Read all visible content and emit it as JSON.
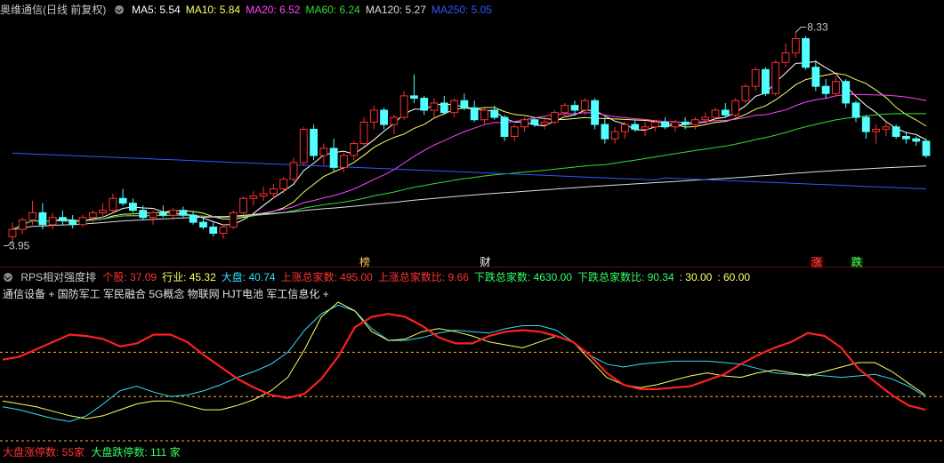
{
  "header": {
    "title": "奥维通信(日线 前复权)",
    "ma": [
      {
        "label": "MA5: 5.54",
        "color": "#ffffff"
      },
      {
        "label": "MA10: 5.84",
        "color": "#ffff66"
      },
      {
        "label": "MA20: 6.52",
        "color": "#ff44ff"
      },
      {
        "label": "MA60: 6.24",
        "color": "#33dd33"
      },
      {
        "label": "MA120: 5.27",
        "color": "#dddddd"
      },
      {
        "label": "MA250: 5.05",
        "color": "#3355ff"
      }
    ]
  },
  "price_chart": {
    "high_label": "8.33",
    "low_label": "3.95",
    "events": [
      {
        "text": "榜",
        "color": "#ffcc66"
      },
      {
        "text": "财",
        "color": "#ffffff"
      },
      {
        "text": "涨",
        "color": "#ff5555"
      },
      {
        "text": "跌",
        "color": "#66ff66"
      }
    ]
  },
  "rps": {
    "name": "RPS相对强度排",
    "items": [
      {
        "label": "个股: 37.09",
        "color": "#ff3333"
      },
      {
        "label": "行业: 45.32",
        "color": "#ffff66"
      },
      {
        "label": "大盘: 40.74",
        "color": "#33ddff"
      },
      {
        "label": "上涨总家数: 495.00",
        "color": "#ff3333"
      },
      {
        "label": "上涨总家数比: 9.66",
        "color": "#ff3333"
      },
      {
        "label": "下跌总家数: 4630.00",
        "color": "#33ff66"
      },
      {
        "label": "下跌总家数比: 90.34",
        "color": "#33ff66"
      },
      {
        "label": ": 30.00",
        "color": "#ffff66"
      },
      {
        "label": ": 60.00",
        "color": "#ffff66"
      }
    ],
    "sectors": "通信设备 + 国防军工 军民融合 5G概念 物联网 HJT电池 军工信息化 +",
    "limit_up": "大盘涨停数: 55家",
    "limit_down": "大盘跌停数: 111 家"
  },
  "chart_data": [
    {
      "type": "candlestick",
      "title": "奥维通信(日线 前复权)",
      "ylim": [
        3.7,
        8.6
      ],
      "annotations": {
        "max": 8.33,
        "min": 3.95
      },
      "ohlc": [
        [
          4.05,
          4.35,
          3.95,
          4.2
        ],
        [
          4.2,
          4.45,
          4.1,
          4.4
        ],
        [
          4.4,
          4.8,
          4.3,
          4.55
        ],
        [
          4.55,
          4.75,
          4.2,
          4.3
        ],
        [
          4.3,
          4.55,
          4.2,
          4.45
        ],
        [
          4.45,
          4.6,
          4.3,
          4.38
        ],
        [
          4.38,
          4.5,
          4.22,
          4.3
        ],
        [
          4.3,
          4.5,
          4.25,
          4.45
        ],
        [
          4.45,
          4.6,
          4.35,
          4.55
        ],
        [
          4.55,
          4.75,
          4.45,
          4.6
        ],
        [
          4.6,
          4.95,
          4.55,
          4.85
        ],
        [
          4.85,
          5.05,
          4.7,
          4.75
        ],
        [
          4.75,
          4.85,
          4.55,
          4.6
        ],
        [
          4.6,
          4.7,
          4.4,
          4.45
        ],
        [
          4.45,
          4.6,
          4.3,
          4.55
        ],
        [
          4.55,
          4.7,
          4.45,
          4.5
        ],
        [
          4.5,
          4.65,
          4.4,
          4.6
        ],
        [
          4.6,
          4.68,
          4.45,
          4.5
        ],
        [
          4.5,
          4.58,
          4.3,
          4.35
        ],
        [
          4.35,
          4.45,
          4.2,
          4.25
        ],
        [
          4.25,
          4.35,
          4.05,
          4.12
        ],
        [
          4.12,
          4.3,
          4.0,
          4.25
        ],
        [
          4.25,
          4.6,
          4.2,
          4.55
        ],
        [
          4.55,
          4.9,
          4.5,
          4.85
        ],
        [
          4.85,
          5.0,
          4.7,
          4.9
        ],
        [
          4.9,
          5.1,
          4.8,
          4.95
        ],
        [
          4.95,
          5.15,
          4.85,
          5.05
        ],
        [
          5.05,
          5.3,
          4.95,
          5.25
        ],
        [
          5.25,
          5.7,
          5.2,
          5.6
        ],
        [
          5.6,
          6.35,
          5.55,
          6.3
        ],
        [
          6.3,
          6.4,
          5.65,
          5.75
        ],
        [
          5.75,
          6.0,
          5.55,
          5.9
        ],
        [
          5.9,
          6.1,
          5.4,
          5.5
        ],
        [
          5.5,
          5.8,
          5.4,
          5.75
        ],
        [
          5.75,
          6.05,
          5.65,
          6.0
        ],
        [
          6.0,
          6.55,
          5.95,
          6.45
        ],
        [
          6.45,
          6.8,
          6.3,
          6.7
        ],
        [
          6.7,
          6.75,
          6.3,
          6.4
        ],
        [
          6.4,
          6.6,
          6.2,
          6.55
        ],
        [
          6.55,
          7.1,
          6.5,
          7.0
        ],
        [
          7.0,
          7.45,
          6.85,
          6.95
        ],
        [
          6.95,
          7.0,
          6.6,
          6.7
        ],
        [
          6.7,
          6.95,
          6.55,
          6.85
        ],
        [
          6.85,
          7.0,
          6.6,
          6.65
        ],
        [
          6.65,
          6.95,
          6.55,
          6.9
        ],
        [
          6.9,
          7.05,
          6.7,
          6.75
        ],
        [
          6.75,
          6.9,
          6.45,
          6.5
        ],
        [
          6.5,
          6.75,
          6.4,
          6.7
        ],
        [
          6.7,
          6.8,
          6.5,
          6.55
        ],
        [
          6.55,
          6.6,
          6.05,
          6.15
        ],
        [
          6.15,
          6.4,
          6.05,
          6.35
        ],
        [
          6.35,
          6.55,
          6.25,
          6.5
        ],
        [
          6.5,
          6.55,
          6.35,
          6.4
        ],
        [
          6.4,
          6.55,
          6.3,
          6.45
        ],
        [
          6.45,
          6.7,
          6.4,
          6.65
        ],
        [
          6.65,
          6.85,
          6.55,
          6.8
        ],
        [
          6.8,
          6.9,
          6.6,
          6.7
        ],
        [
          6.7,
          6.95,
          6.6,
          6.9
        ],
        [
          6.9,
          6.95,
          6.3,
          6.4
        ],
        [
          6.4,
          6.55,
          6.0,
          6.1
        ],
        [
          6.1,
          6.35,
          6.0,
          6.25
        ],
        [
          6.25,
          6.45,
          6.1,
          6.4
        ],
        [
          6.4,
          6.5,
          6.25,
          6.3
        ],
        [
          6.3,
          6.45,
          6.15,
          6.35
        ],
        [
          6.35,
          6.5,
          6.25,
          6.45
        ],
        [
          6.45,
          6.55,
          6.3,
          6.35
        ],
        [
          6.35,
          6.5,
          6.25,
          6.45
        ],
        [
          6.45,
          6.55,
          6.3,
          6.4
        ],
        [
          6.4,
          6.55,
          6.3,
          6.5
        ],
        [
          6.5,
          6.65,
          6.4,
          6.55
        ],
        [
          6.55,
          6.75,
          6.45,
          6.7
        ],
        [
          6.7,
          6.85,
          6.55,
          6.6
        ],
        [
          6.6,
          6.95,
          6.55,
          6.9
        ],
        [
          6.9,
          7.25,
          6.85,
          7.2
        ],
        [
          7.2,
          7.6,
          7.1,
          7.55
        ],
        [
          7.55,
          7.6,
          7.0,
          7.05
        ],
        [
          7.05,
          7.75,
          7.0,
          7.7
        ],
        [
          7.7,
          8.1,
          7.6,
          7.9
        ],
        [
          7.9,
          8.33,
          7.8,
          8.2
        ],
        [
          8.2,
          8.25,
          7.55,
          7.6
        ],
        [
          7.6,
          7.75,
          7.1,
          7.2
        ],
        [
          7.2,
          7.35,
          6.95,
          7.05
        ],
        [
          7.05,
          7.4,
          7.0,
          7.3
        ],
        [
          7.3,
          7.35,
          6.75,
          6.85
        ],
        [
          6.85,
          6.9,
          6.45,
          6.55
        ],
        [
          6.55,
          6.6,
          6.1,
          6.25
        ],
        [
          6.25,
          6.4,
          6.0,
          6.3
        ],
        [
          6.3,
          6.45,
          6.15,
          6.35
        ],
        [
          6.35,
          6.4,
          6.1,
          6.15
        ],
        [
          6.15,
          6.25,
          6.0,
          6.1
        ],
        [
          6.1,
          6.15,
          5.95,
          6.05
        ],
        [
          6.05,
          6.1,
          5.7,
          5.75
        ]
      ]
    },
    {
      "type": "line",
      "title": "RPS相对强度排",
      "ylim": [
        0,
        100
      ],
      "reference_lines": [
        30,
        60
      ],
      "series": [
        {
          "name": "个股",
          "color": "#ff2020",
          "values": [
            55,
            57,
            62,
            67,
            72,
            71,
            69,
            64,
            66,
            72,
            72,
            67,
            58,
            50,
            42,
            36,
            31,
            29,
            32,
            42,
            57,
            77,
            84,
            86,
            84,
            78,
            70,
            66,
            66,
            71,
            74,
            75,
            74,
            71,
            67,
            58,
            46,
            38,
            35,
            35,
            36,
            37,
            41,
            45,
            52,
            58,
            63,
            67,
            73,
            71,
            63,
            49,
            40,
            31,
            24,
            21
          ]
        },
        {
          "name": "行业",
          "color": "#ffff66",
          "values": [
            27,
            25,
            23,
            20,
            17,
            15,
            17,
            21,
            25,
            27,
            27,
            24,
            21,
            21,
            24,
            28,
            34,
            43,
            62,
            84,
            94,
            88,
            74,
            68,
            69,
            74,
            76,
            74,
            71,
            67,
            65,
            63,
            67,
            71,
            67,
            55,
            43,
            38,
            36,
            38,
            41,
            44,
            46,
            44,
            43,
            46,
            48,
            46,
            44,
            47,
            50,
            53,
            53,
            47,
            39,
            31
          ]
        },
        {
          "name": "大盘",
          "color": "#33ddff",
          "values": [
            23,
            21,
            18,
            15,
            13,
            17,
            25,
            34,
            37,
            33,
            30,
            31,
            34,
            38,
            43,
            47,
            52,
            60,
            75,
            86,
            92,
            88,
            76,
            68,
            68,
            70,
            73,
            75,
            74,
            73,
            76,
            78,
            78,
            75,
            67,
            58,
            52,
            50,
            52,
            53,
            54,
            54,
            54,
            53,
            52,
            49,
            46,
            45,
            45,
            44,
            43,
            44,
            45,
            42,
            37,
            30
          ]
        }
      ]
    }
  ]
}
